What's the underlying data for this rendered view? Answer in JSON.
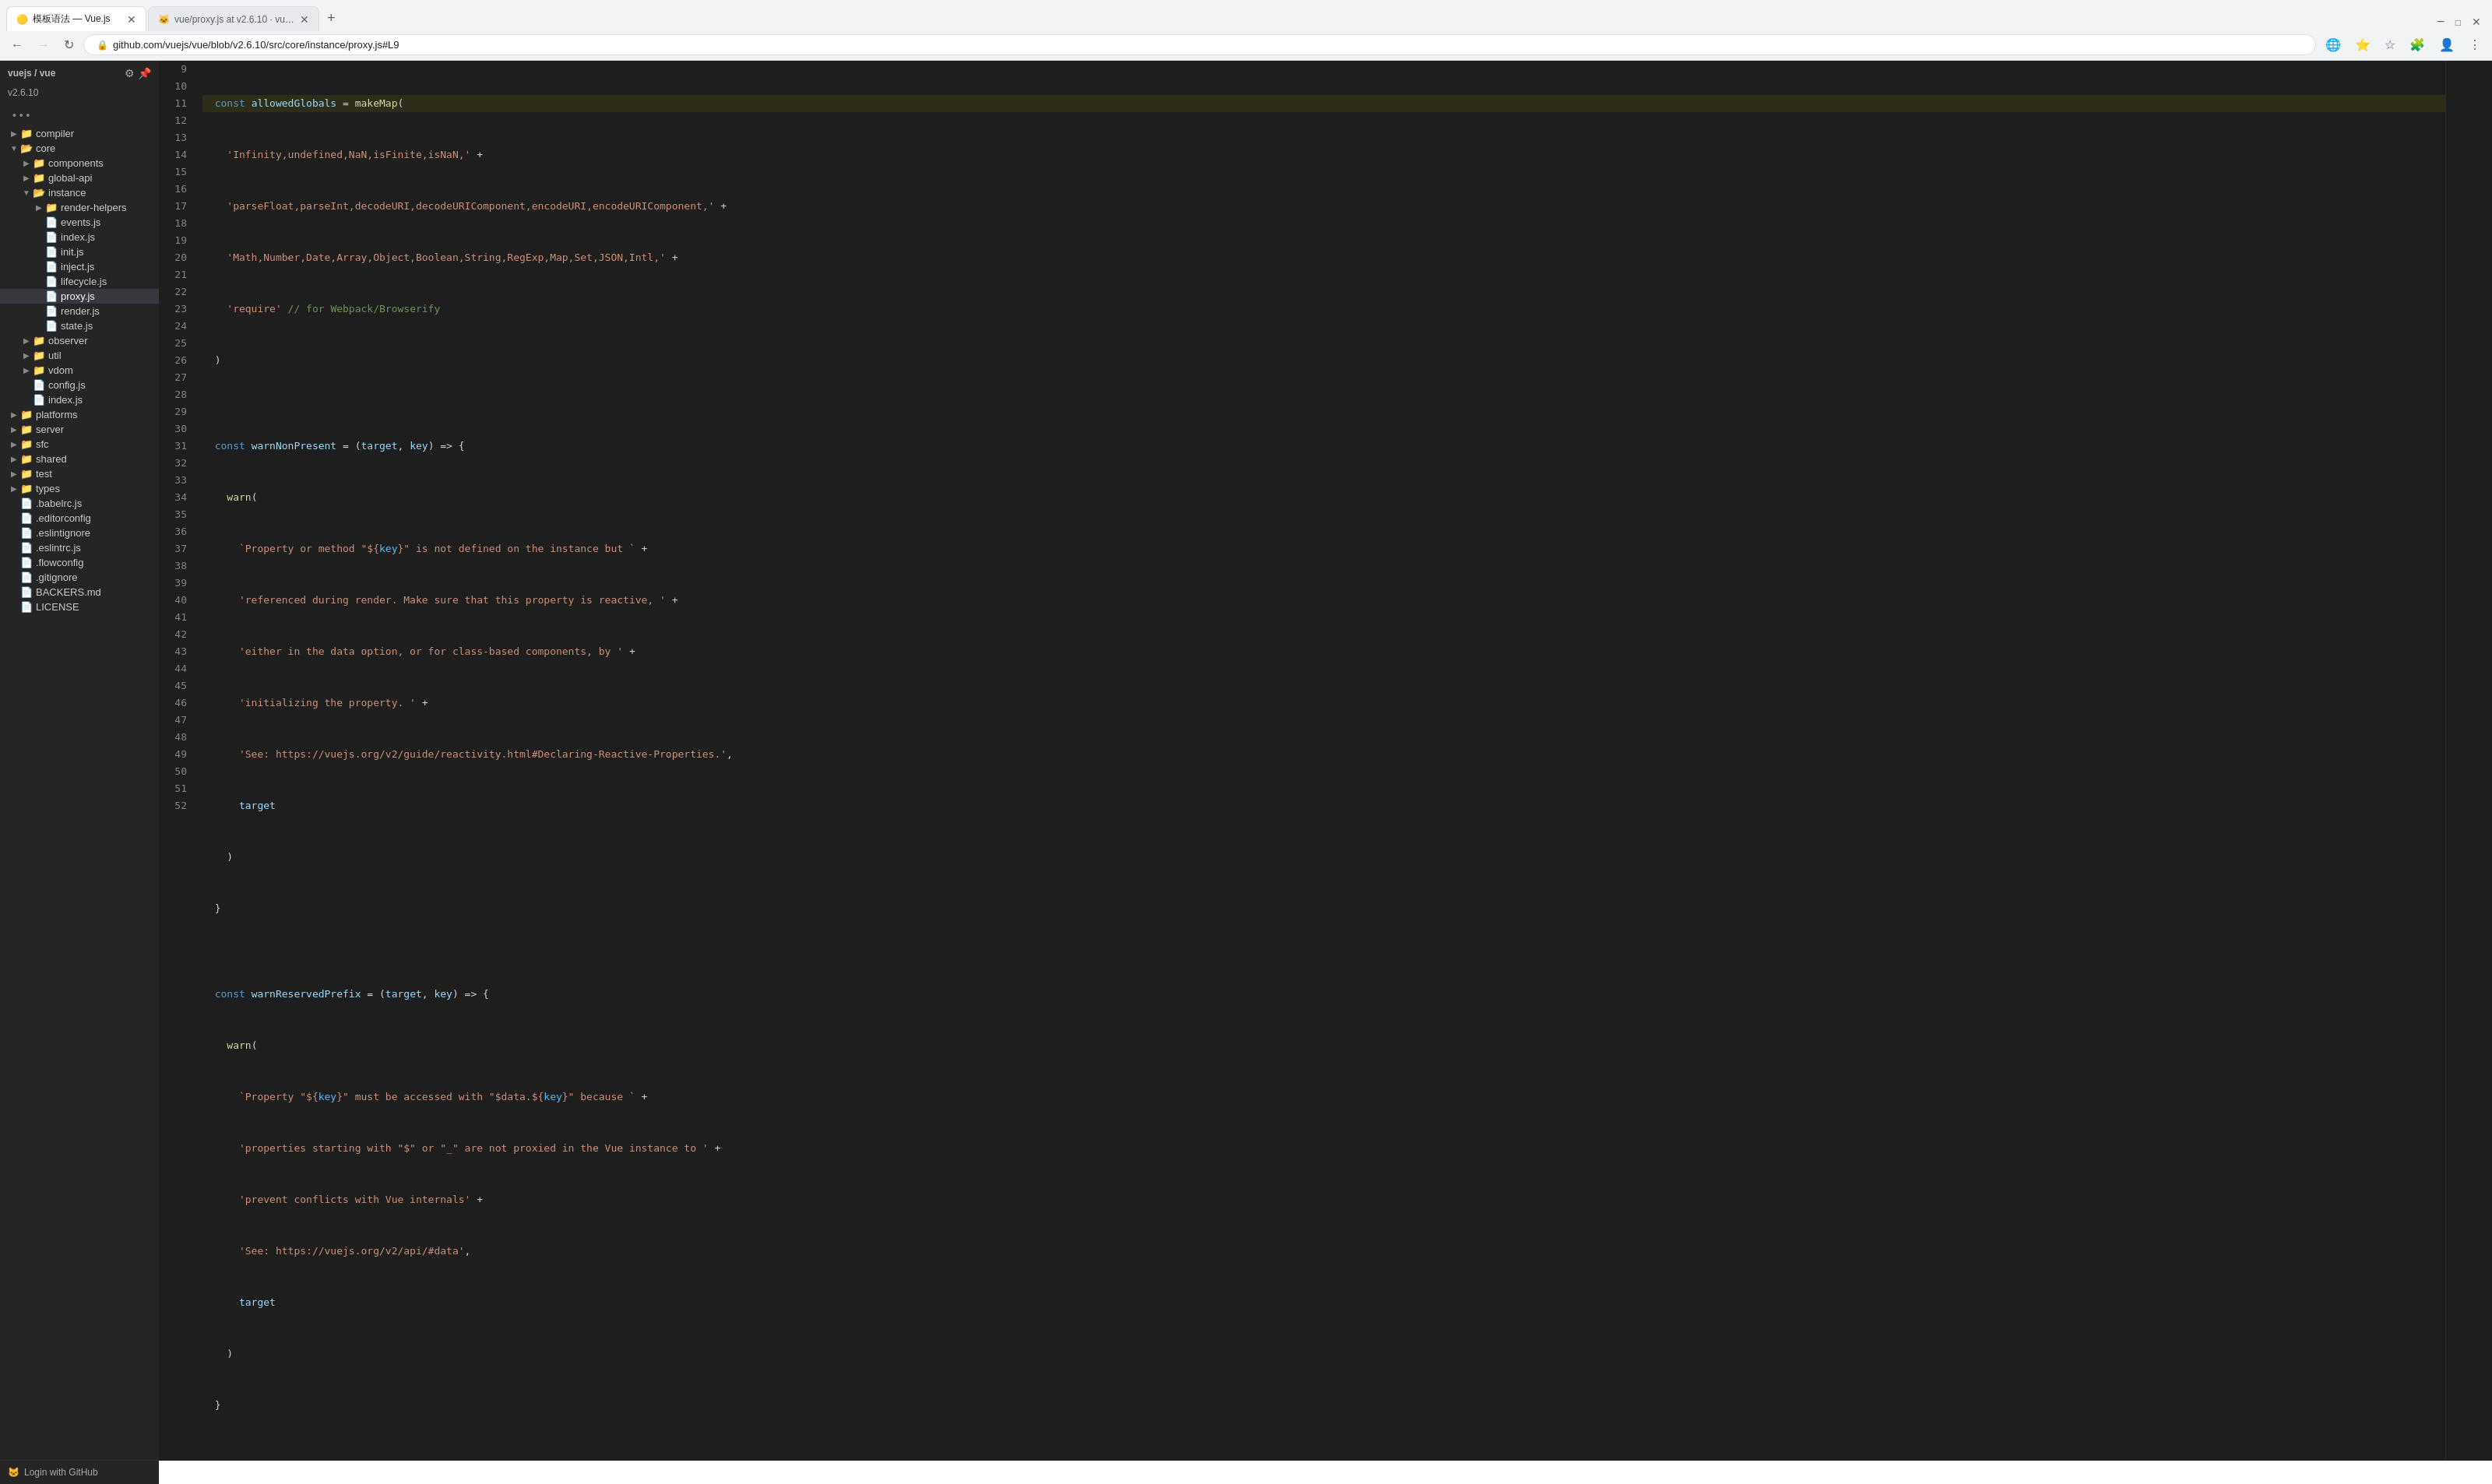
{
  "browser": {
    "tabs": [
      {
        "id": "tab1",
        "title": "模板语法 — Vue.js",
        "favicon": "📄",
        "active": true
      },
      {
        "id": "tab2",
        "title": "vue/proxy.js at v2.6.10 · vue/...",
        "favicon": "🐙",
        "active": false
      }
    ],
    "address": "github.com/vuejs/vue/blob/v2.6.10/src/core/instance/proxy.js#L9",
    "new_tab_label": "+"
  },
  "sidebar": {
    "repo": "vuejs / vue",
    "branch": "v2.6.10",
    "tree": [
      {
        "id": "compiler",
        "name": "compiler",
        "type": "folder",
        "indent": 1,
        "expanded": false
      },
      {
        "id": "core",
        "name": "core",
        "type": "folder",
        "indent": 1,
        "expanded": true
      },
      {
        "id": "components",
        "name": "components",
        "type": "folder",
        "indent": 2,
        "expanded": false
      },
      {
        "id": "global-api",
        "name": "global-api",
        "type": "folder",
        "indent": 2,
        "expanded": false
      },
      {
        "id": "instance",
        "name": "instance",
        "type": "folder",
        "indent": 2,
        "expanded": true
      },
      {
        "id": "render-helpers",
        "name": "render-helpers",
        "type": "folder",
        "indent": 3,
        "expanded": false
      },
      {
        "id": "events.js",
        "name": "events.js",
        "type": "file",
        "indent": 3,
        "expanded": false
      },
      {
        "id": "index.js",
        "name": "index.js",
        "type": "file",
        "indent": 3
      },
      {
        "id": "init.js",
        "name": "init.js",
        "type": "file",
        "indent": 3
      },
      {
        "id": "inject.js",
        "name": "inject.js",
        "type": "file",
        "indent": 3
      },
      {
        "id": "lifecycle.js",
        "name": "lifecycle.js",
        "type": "file",
        "indent": 3
      },
      {
        "id": "proxy.js",
        "name": "proxy.js",
        "type": "file",
        "indent": 3,
        "selected": true
      },
      {
        "id": "render.js",
        "name": "render.js",
        "type": "file",
        "indent": 3
      },
      {
        "id": "state.js",
        "name": "state.js",
        "type": "file",
        "indent": 3
      },
      {
        "id": "observer",
        "name": "observer",
        "type": "folder",
        "indent": 2,
        "expanded": false
      },
      {
        "id": "util",
        "name": "util",
        "type": "folder",
        "indent": 2,
        "expanded": false
      },
      {
        "id": "vdom",
        "name": "vdom",
        "type": "folder",
        "indent": 2,
        "expanded": false
      },
      {
        "id": "config.js",
        "name": "config.js",
        "type": "file",
        "indent": 2
      },
      {
        "id": "index.js2",
        "name": "index.js",
        "type": "file",
        "indent": 2
      },
      {
        "id": "platforms",
        "name": "platforms",
        "type": "folder",
        "indent": 1,
        "expanded": false
      },
      {
        "id": "server",
        "name": "server",
        "type": "folder",
        "indent": 1,
        "expanded": false
      },
      {
        "id": "sfc",
        "name": "sfc",
        "type": "folder",
        "indent": 1,
        "expanded": false
      },
      {
        "id": "shared",
        "name": "shared",
        "type": "folder",
        "indent": 1,
        "expanded": false
      },
      {
        "id": "test",
        "name": "test",
        "type": "folder",
        "indent": 1,
        "expanded": false
      },
      {
        "id": "types",
        "name": "types",
        "type": "folder",
        "indent": 1,
        "expanded": false
      },
      {
        "id": "babelrc.js",
        "name": ".babelrc.js",
        "type": "file",
        "indent": 0
      },
      {
        "id": "editorconfig",
        "name": ".editorconfig",
        "type": "file",
        "indent": 0
      },
      {
        "id": "eslintignore",
        "name": ".eslintignore",
        "type": "file",
        "indent": 0
      },
      {
        "id": "eslintrc.js",
        "name": ".eslintrc.js",
        "type": "file",
        "indent": 0
      },
      {
        "id": "flowconfig",
        "name": ".flowconfig",
        "type": "file",
        "indent": 0
      },
      {
        "id": "gitignore",
        "name": ".gitignore",
        "type": "file",
        "indent": 0
      },
      {
        "id": "BACKERS",
        "name": "BACKERS.md",
        "type": "file",
        "indent": 0
      },
      {
        "id": "LICENSE",
        "name": "LICENSE",
        "type": "file",
        "indent": 0
      }
    ],
    "login_label": "Login with GitHub"
  },
  "code": {
    "lines": [
      {
        "num": 9,
        "highlighted": true
      },
      {
        "num": 10
      },
      {
        "num": 11
      },
      {
        "num": 12
      },
      {
        "num": 13
      },
      {
        "num": 14
      },
      {
        "num": 15
      },
      {
        "num": 16
      },
      {
        "num": 17
      },
      {
        "num": 18
      },
      {
        "num": 19
      },
      {
        "num": 20
      },
      {
        "num": 21
      },
      {
        "num": 22
      },
      {
        "num": 23
      },
      {
        "num": 24
      },
      {
        "num": 25
      },
      {
        "num": 26
      },
      {
        "num": 27
      },
      {
        "num": 28
      },
      {
        "num": 29
      },
      {
        "num": 30
      },
      {
        "num": 31
      },
      {
        "num": 32
      },
      {
        "num": 33
      },
      {
        "num": 34
      },
      {
        "num": 35
      },
      {
        "num": 36
      },
      {
        "num": 37
      },
      {
        "num": 38
      },
      {
        "num": 39
      },
      {
        "num": 40
      },
      {
        "num": 41
      },
      {
        "num": 42
      },
      {
        "num": 43
      },
      {
        "num": 44
      },
      {
        "num": 45
      },
      {
        "num": 46
      },
      {
        "num": 47
      },
      {
        "num": 48
      },
      {
        "num": 49
      },
      {
        "num": 50
      },
      {
        "num": 51
      },
      {
        "num": 52
      }
    ]
  }
}
